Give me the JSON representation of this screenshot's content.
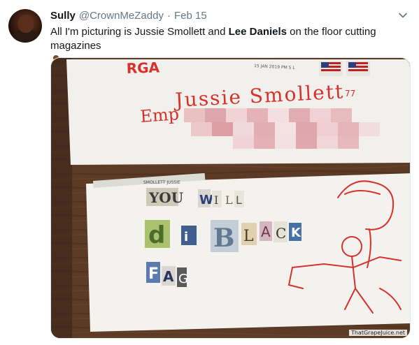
{
  "tweet": {
    "display_name": "Sully",
    "handle": "@CrownMeZaddy",
    "separator": "·",
    "date": "Feb 15",
    "text_before": "All I'm picturing is Jussie Smollett and ",
    "text_bold": "Lee Daniels",
    "text_after": " on the floor cutting magazines",
    "emoji": "person-getting-haircut-emoji"
  },
  "media": {
    "envelope_top": {
      "stamp_postmark": "15 JAN 2019 PM 5 L",
      "handwritten_name": "Jussie Smollett77",
      "prefix_text": "Emp",
      "corner_text": "RGA"
    },
    "envelope_bottom": {
      "label": "SMOLLETT JUSSIE",
      "ransom_words": [
        "YOU",
        "WILL",
        "die",
        "BLACK",
        "FAG"
      ]
    },
    "watermark": "ThatGrapeJuice.net"
  },
  "colors": {
    "marker_red": "#d8312b",
    "wood": "#5b3a26",
    "link_gray": "#657786"
  }
}
